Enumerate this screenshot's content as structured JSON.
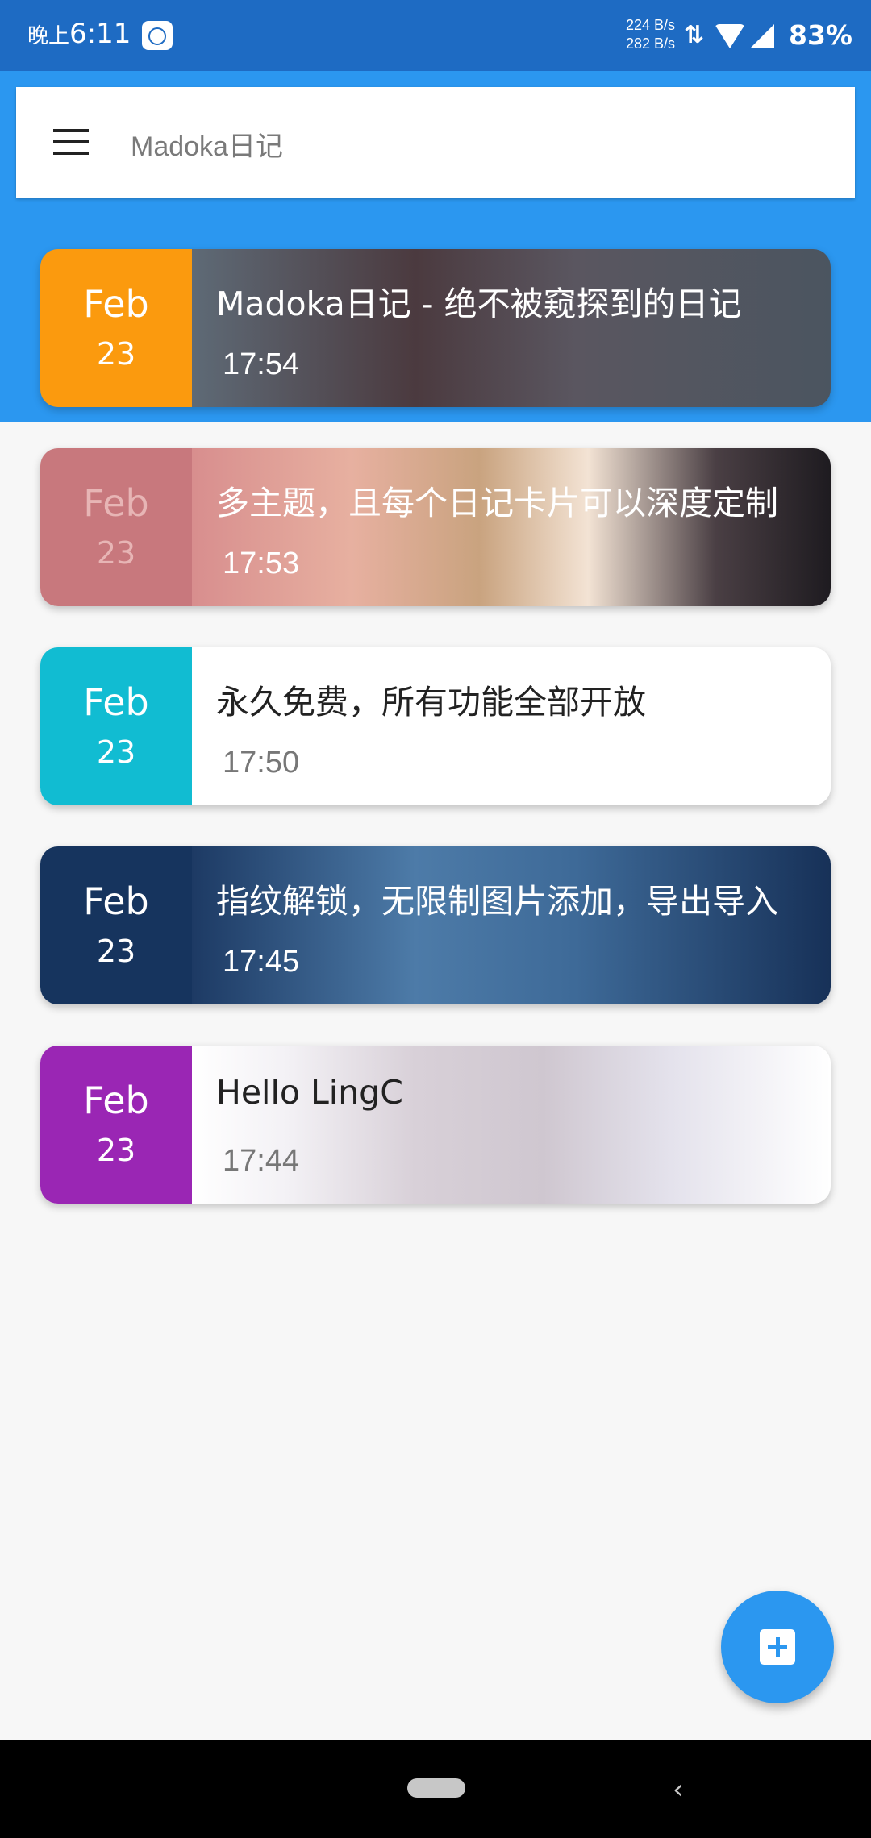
{
  "status_bar": {
    "time_prefix": "晚上",
    "time": "6:11",
    "net_up": "224 B/s",
    "net_down": "282 B/s",
    "battery": "83%"
  },
  "search": {
    "placeholder": "Madoka日记"
  },
  "entries": [
    {
      "month": "Feb",
      "day": "23",
      "title": "Madoka日记 - 绝不被窥探到的日记",
      "time": "17:54",
      "accent": "#fb9a0e"
    },
    {
      "month": "Feb",
      "day": "23",
      "title": "多主题，且每个日记卡片可以深度定制",
      "time": "17:53",
      "accent": "#c8787d"
    },
    {
      "month": "Feb",
      "day": "23",
      "title": "永久免费，所有功能全部开放",
      "time": "17:50",
      "accent": "#11bcd2"
    },
    {
      "month": "Feb",
      "day": "23",
      "title": "指纹解锁，无限制图片添加，导出导入",
      "time": "17:45",
      "accent": "#16345e"
    },
    {
      "month": "Feb",
      "day": "23",
      "title": "Hello LingC",
      "time": "17:44",
      "accent": "#9a26b4"
    }
  ],
  "colors": {
    "primary": "#2b97f0",
    "status_bar": "#1e6bc3"
  },
  "icons": {
    "menu": "menu-icon",
    "fab": "add-box-icon"
  }
}
